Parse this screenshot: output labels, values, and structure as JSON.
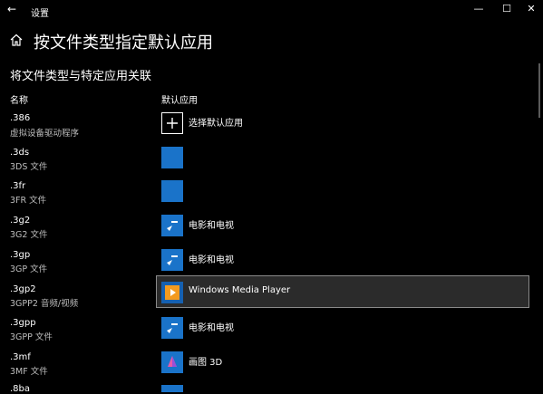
{
  "window": {
    "back_label": "←",
    "title": "设置",
    "minimize": "—",
    "maximize": "☐",
    "close": "✕"
  },
  "header": {
    "home_icon": "home-icon",
    "title": "按文件类型指定默认应用"
  },
  "section": {
    "title": "将文件类型与特定应用关联"
  },
  "columns": {
    "name": "名称",
    "default_app": "默认应用"
  },
  "rows": [
    {
      "ext": ".386",
      "desc": "虚拟设备驱动程序",
      "app": "选择默认应用",
      "icon": "plus-icon"
    },
    {
      "ext": ".3ds",
      "desc": "3DS 文件",
      "app": "",
      "icon": "blank-app-icon"
    },
    {
      "ext": ".3fr",
      "desc": "3FR 文件",
      "app": "",
      "icon": "blank-app-icon"
    },
    {
      "ext": ".3g2",
      "desc": "3G2 文件",
      "app": "电影和电视",
      "icon": "movies-tv-icon"
    },
    {
      "ext": ".3gp",
      "desc": "3GP 文件",
      "app": "电影和电视",
      "icon": "movies-tv-icon"
    },
    {
      "ext": ".3gp2",
      "desc": "3GPP2 音频/视频",
      "app": "Windows Media Player",
      "icon": "media-player-icon"
    },
    {
      "ext": ".3gpp",
      "desc": "3GPP 文件",
      "app": "电影和电视",
      "icon": "movies-tv-icon"
    },
    {
      "ext": ".3mf",
      "desc": "3MF 文件",
      "app": "画图 3D",
      "icon": "paint3d-icon"
    },
    {
      "ext": ".8ba",
      "desc": "",
      "app": "",
      "icon": "blank-app-icon"
    }
  ],
  "colors": {
    "accent": "#1a73c9",
    "selected_bg": "#2b2b2b",
    "selected_border": "#8a8a8a"
  }
}
